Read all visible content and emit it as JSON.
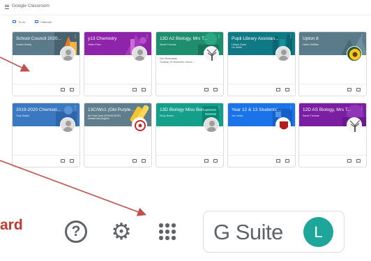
{
  "app": {
    "title": "Google Classroom"
  },
  "subbar": {
    "to_do": "To-do",
    "calendar": "Calendar"
  },
  "cards_row1": [
    {
      "title": "School Council 2020...",
      "subtitle": "Louise Gurley",
      "color": "#5b7a8a",
      "avatar": "person"
    },
    {
      "title": "y13 Chemistry",
      "subtitle": "Helen Price",
      "color": "#8e24aa",
      "avatar": "person"
    },
    {
      "title": "13D A2 Biology, Mrs T...",
      "subtitle": "Sarah Thomas",
      "color": "#1e8e6e",
      "avatar": "photo-tree",
      "due_label": "Due Wednesday",
      "due_item": "Tuesday, 24 November Lesson ..."
    },
    {
      "title": "Pupil Library Assistan...",
      "subtitle": "Library Clubs",
      "subtitle2": "Liz Smith",
      "color": "#0f7a85",
      "avatar": "person"
    },
    {
      "title": "Upton 8",
      "subtitle": "Helen Griffiths",
      "color": "#5a7b89",
      "avatar": "photo-sunflower"
    }
  ],
  "cards_row2": [
    {
      "title": "2019-2020 Chemistr...",
      "subtitle": "Tony Goldin",
      "color": "#3a78c2",
      "avatar": "person"
    },
    {
      "title": "13C/Wc1 (Old Purple...",
      "subtitle": "Mr Price Dept (GHS/KD/ESF)",
      "subtitle2": "Debbie McLaughlin",
      "color": "#607d8b",
      "avatar": "photo-badge"
    },
    {
      "title": "13D Biology Miss Ben...",
      "subtitle": "Emily Bower",
      "color": "#149f8b",
      "avatar": "person"
    },
    {
      "title": "Year 12 & 13 Students'...",
      "subtitle": "Jon Jones",
      "color": "#1a73e8",
      "avatar": "photo-badge"
    },
    {
      "title": "12D AS Biology, Mrs T...",
      "subtitle": "Sarah Thomas",
      "color": "#7b1fa2",
      "avatar": "photo-tree"
    }
  ],
  "annotation": {
    "label_fragment": "ard",
    "arrow_color": "#c0504d"
  },
  "bottom_toolbar": {
    "help_glyph": "?",
    "settings_glyph": "⚙",
    "product_name": "G Suite",
    "user_initial": "L"
  }
}
